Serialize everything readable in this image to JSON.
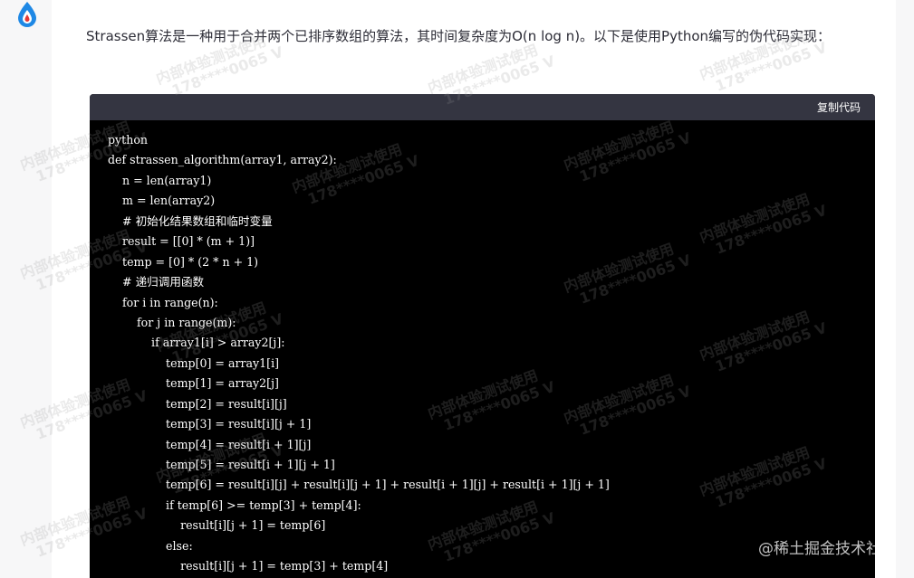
{
  "message": {
    "intro": "Strassen算法是一种用于合并两个已排序数组的算法，其时间复杂度为O(n log n)。以下是使用Python编写的伪代码实现："
  },
  "code_block": {
    "copy_label": "复制代码",
    "lines": [
      "python",
      "def strassen_algorithm(array1, array2):",
      "    n = len(array1)",
      "    m = len(array2)",
      "    # 初始化结果数组和临时变量",
      "    result = [[0] * (m + 1)]",
      "    temp = [0] * (2 * n + 1)",
      "    # 递归调用函数",
      "    for i in range(n):",
      "        for j in range(m):",
      "            if array1[i] > array2[j]:",
      "                temp[0] = array1[i]",
      "                temp[1] = array2[j]",
      "                temp[2] = result[i][j]",
      "                temp[3] = result[i][j + 1]",
      "                temp[4] = result[i + 1][j]",
      "                temp[5] = result[i + 1][j + 1]",
      "                temp[6] = result[i][j] + result[i][j + 1] + result[i + 1][j] + result[i + 1][j + 1]",
      "                if temp[6] >= temp[3] + temp[4]:",
      "                    result[i][j + 1] = temp[6]",
      "                else:",
      "                    result[i][j + 1] = temp[3] + temp[4]"
    ]
  },
  "watermark": {
    "line1": "内部体验测试使用",
    "line2": "178****0065 V",
    "brand": "@稀土掘金技术社区"
  },
  "colors": {
    "page_bg": "#f7f7f8",
    "card_bg": "#ffffff",
    "code_bg": "#000000",
    "code_header_bg": "#343541",
    "avatar_blue": "#1e88e5",
    "avatar_red": "#e53935"
  },
  "icons": {
    "avatar": "assistant-logo-icon"
  }
}
